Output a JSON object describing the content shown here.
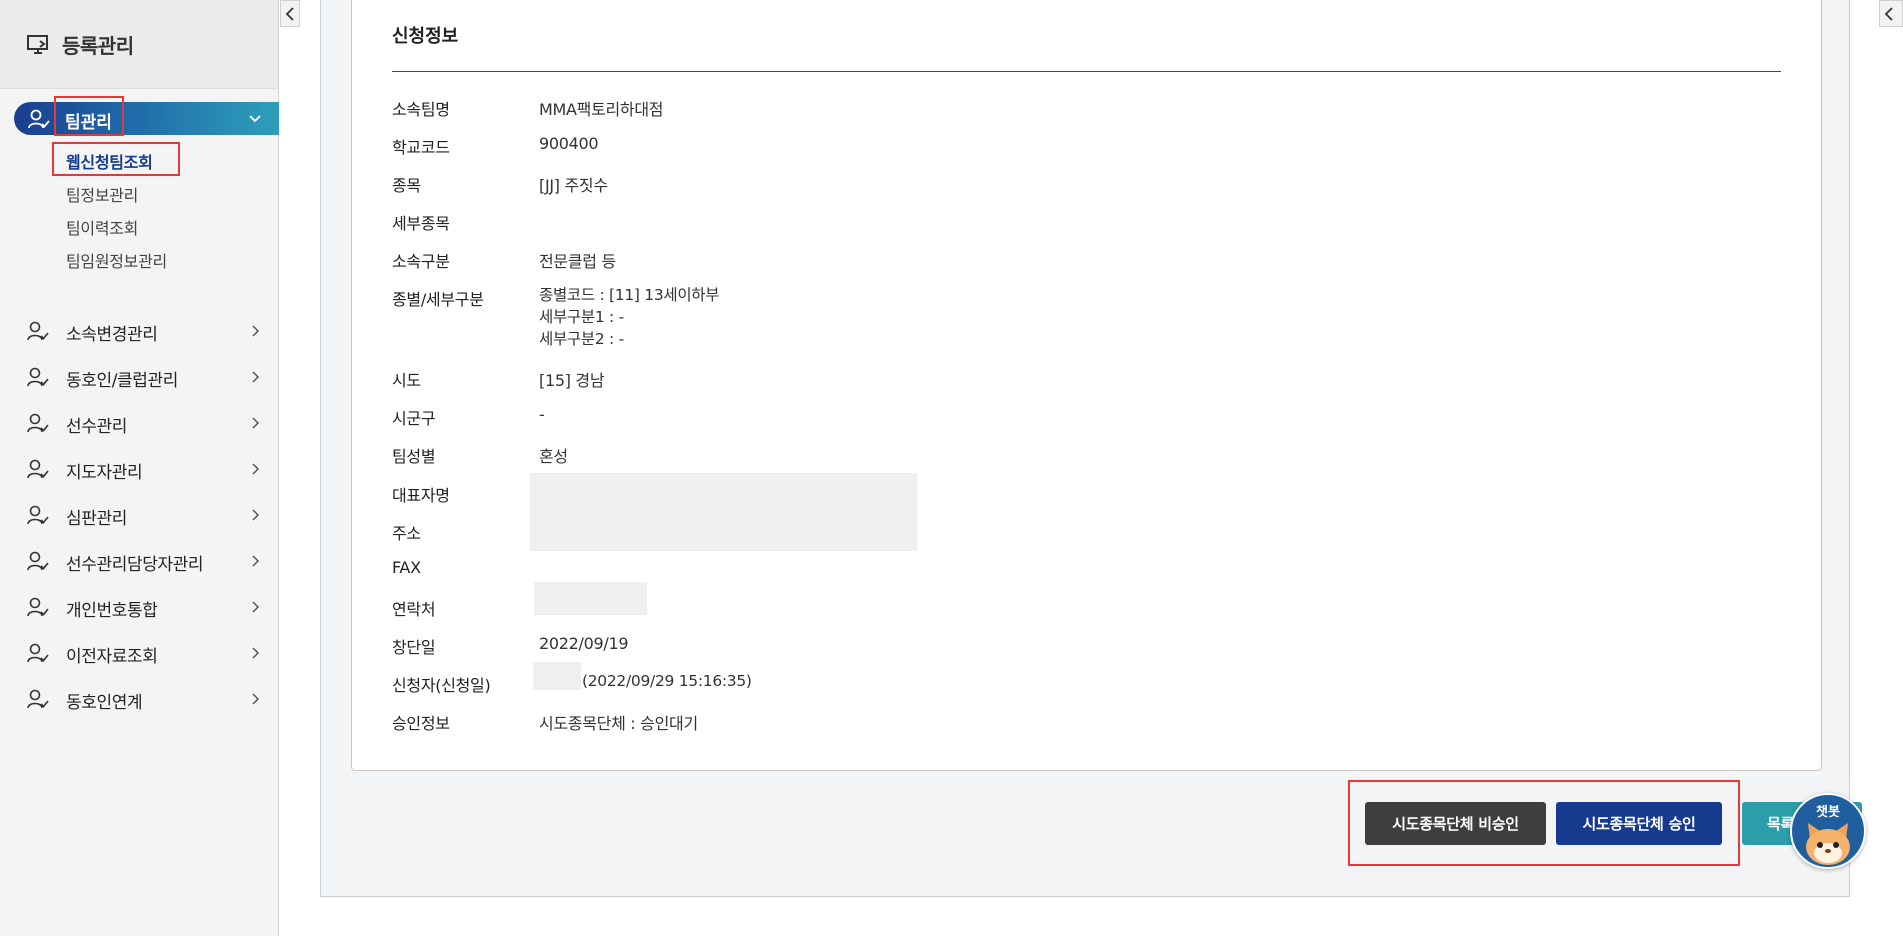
{
  "sidebar": {
    "header_title": "등록관리",
    "active_menu": {
      "label": "팀관리"
    },
    "sub_items": [
      {
        "label": "웹신청팀조회",
        "selected": true
      },
      {
        "label": "팀정보관리",
        "selected": false
      },
      {
        "label": "팀이력조회",
        "selected": false
      },
      {
        "label": "팀임원정보관리",
        "selected": false
      }
    ],
    "menu_items": [
      {
        "label": "소속변경관리"
      },
      {
        "label": "동호인/클럽관리"
      },
      {
        "label": "선수관리"
      },
      {
        "label": "지도자관리"
      },
      {
        "label": "심판관리"
      },
      {
        "label": "선수관리담당자관리"
      },
      {
        "label": "개인번호통합"
      },
      {
        "label": "이전자료조회"
      },
      {
        "label": "동호인연계"
      }
    ]
  },
  "card": {
    "title": "신청정보",
    "rows": [
      {
        "label": "소속팀명",
        "value": "MMA팩토리하대점"
      },
      {
        "label": "학교코드",
        "value": "900400"
      },
      {
        "label": "종목",
        "value": "[JJ] 주짓수"
      },
      {
        "label": "세부종목",
        "value": ""
      },
      {
        "label": "소속구분",
        "value": "전문클럽 등"
      },
      {
        "label": "종별/세부구분",
        "lines": [
          "종별코드 : [11] 13세이하부",
          "세부구분1 : -",
          "세부구분2 : -"
        ]
      },
      {
        "label": "시도",
        "value": "[15] 경남"
      },
      {
        "label": "시군구",
        "value": "-"
      },
      {
        "label": "팀성별",
        "value": "혼성"
      },
      {
        "label": "대표자명",
        "value": ""
      },
      {
        "label": "주소",
        "value": ""
      },
      {
        "label": "FAX",
        "value": ""
      },
      {
        "label": "연락처",
        "value": ""
      },
      {
        "label": "창단일",
        "value": "2022/09/19"
      },
      {
        "label": "신청자(신청일)",
        "value": "(2022/09/29 15:16:35)"
      },
      {
        "label": "승인정보",
        "value": "시도종목단체 : 승인대기"
      }
    ]
  },
  "buttons": {
    "reject": "시도종목단체 비승인",
    "approve": "시도종목단체 승인",
    "list": "목록"
  },
  "chatbot": {
    "label": "챗봇"
  },
  "colors": {
    "accent_blue": "#163a8d",
    "dark_button": "#3e3e3e",
    "teal_button": "#2b9eaa",
    "highlight_red": "#e23a3a"
  }
}
